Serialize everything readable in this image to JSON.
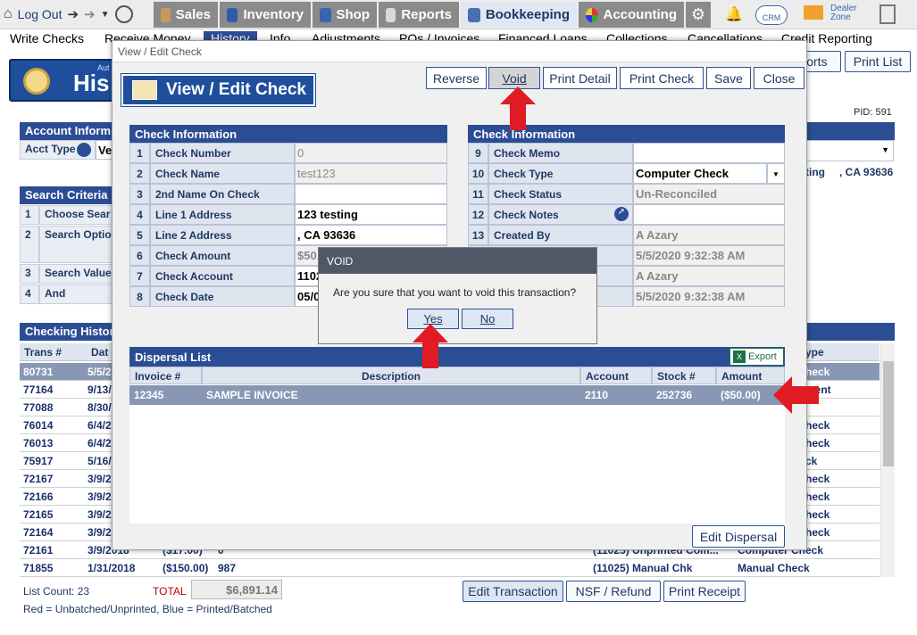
{
  "nav": {
    "logout": "Log Out",
    "tabs": [
      "Sales",
      "Inventory",
      "Shop",
      "Reports",
      "Bookkeeping",
      "Accounting"
    ],
    "crm": "CRM",
    "dealer_zone": "Dealer Zone"
  },
  "subnav": [
    "Write Checks",
    "Receive Money",
    "History",
    "Info",
    "Adjustments",
    "POs / Invoices",
    "Financed Loans",
    "Collections",
    "Cancellations",
    "Credit Reporting"
  ],
  "background": {
    "header_small": "Aut",
    "header": "His",
    "pid": "PID: 591",
    "buttons": {
      "reports": "ports",
      "print_list": "Print List"
    },
    "account_info": {
      "title": "Account Inform",
      "acct_type_label": "Acct Type",
      "acct_type_value": "Ve"
    },
    "address_fragment": "ting",
    "city_state": ", CA 93636",
    "search": {
      "title": "Search Criteria",
      "rows": [
        {
          "num": "1",
          "label": "Choose Sear"
        },
        {
          "num": "2",
          "label": "Search Optio"
        },
        {
          "num": "3",
          "label": "Search Value"
        },
        {
          "num": "4",
          "label": "And"
        }
      ]
    },
    "history": {
      "title": "Checking Histor",
      "col_trans": "Trans #",
      "col_date": "Dat",
      "col_type": "ype",
      "rows": [
        {
          "trans": "80731",
          "date": "5/5/2",
          "type": "heck",
          "highlight": true
        },
        {
          "trans": "77164",
          "date": "9/13/",
          "type": "ment"
        },
        {
          "trans": "77088",
          "date": "8/30/",
          "type": ""
        },
        {
          "trans": "76014",
          "date": "6/4/2",
          "type": "heck"
        },
        {
          "trans": "76013",
          "date": "6/4/2",
          "type": "heck"
        },
        {
          "trans": "75917",
          "date": "5/16/",
          "type": "ck"
        },
        {
          "trans": "72167",
          "date": "3/9/2",
          "type": "heck"
        },
        {
          "trans": "72166",
          "date": "3/9/2",
          "type": "heck"
        },
        {
          "trans": "72165",
          "date": "3/9/2",
          "type": "heck"
        },
        {
          "trans": "72164",
          "date": "3/9/2",
          "type": "heck"
        },
        {
          "trans": "72161",
          "date": "3/9/2018",
          "amount": "($17.00)",
          "checknum": "0",
          "account": "(11025) Unprinted Com...",
          "type": "Computer Check"
        },
        {
          "trans": "71855",
          "date": "1/31/2018",
          "amount": "($150.00)",
          "checknum": "987",
          "account": "(11025) Manual Chk",
          "type": "Manual Check"
        }
      ]
    },
    "footer": {
      "list_count": "List Count: 23",
      "total_label": "TOTAL",
      "total_value": "$6,891.14",
      "legend": "Red = Unbatched/Unprinted, Blue = Printed/Batched",
      "buttons": [
        "Edit Transaction",
        "NSF / Refund",
        "Print Receipt"
      ]
    }
  },
  "modal": {
    "window_title": "View / Edit Check",
    "header": "View / Edit Check",
    "buttons": [
      "Reverse",
      "Void",
      "Print Detail",
      "Print Check",
      "Save",
      "Close"
    ],
    "left_title": "Check Information",
    "right_title": "Check Information",
    "left_rows": [
      {
        "num": "1",
        "label": "Check Number",
        "value": "0",
        "readonly": true
      },
      {
        "num": "2",
        "label": "Check Name",
        "value": "test123",
        "readonly": true
      },
      {
        "num": "3",
        "label": "2nd Name On Check",
        "value": ""
      },
      {
        "num": "4",
        "label": "Line 1 Address",
        "value": "123 testing"
      },
      {
        "num": "5",
        "label": "Line 2 Address",
        "value": ", CA 93636"
      },
      {
        "num": "6",
        "label": "Check Amount",
        "value": "$50.",
        "readonly": true
      },
      {
        "num": "7",
        "label": "Check Account",
        "value": "1102"
      },
      {
        "num": "8",
        "label": "Check Date",
        "value": "05/0"
      }
    ],
    "right_rows": [
      {
        "num": "9",
        "label": "Check Memo",
        "value": ""
      },
      {
        "num": "10",
        "label": "Check Type",
        "value": "Computer Check"
      },
      {
        "num": "11",
        "label": "Check Status",
        "value": "Un-Reconciled",
        "readonly": true
      },
      {
        "num": "12",
        "label": "Check Notes",
        "value": ""
      },
      {
        "num": "13",
        "label": "Created By",
        "value": "A Azary",
        "readonly": true
      },
      {
        "num": "",
        "label": "",
        "value": "5/5/2020 9:32:38 AM",
        "readonly": true
      },
      {
        "num": "",
        "label": "",
        "value": "A Azary",
        "readonly": true
      },
      {
        "num": "",
        "label": "",
        "value": "5/5/2020 9:32:38 AM",
        "readonly": true
      }
    ],
    "dispersal": {
      "title": "Dispersal List",
      "export": "Export",
      "columns": [
        "Invoice #",
        "Description",
        "Account",
        "Stock #",
        "Amount"
      ],
      "rows": [
        {
          "invoice": "12345",
          "description": "SAMPLE INVOICE",
          "account": "2110",
          "stock": "252736",
          "amount": "($50.00)"
        }
      ],
      "edit_button": "Edit Dispersal"
    }
  },
  "void_dialog": {
    "title": "VOID",
    "message": "Are you sure that you want to void this transaction?",
    "yes": "Yes",
    "no": "No"
  },
  "colors": {
    "accent": "#2b4d94",
    "arrow": "#e01b24",
    "selected_row": "#8898b4"
  }
}
